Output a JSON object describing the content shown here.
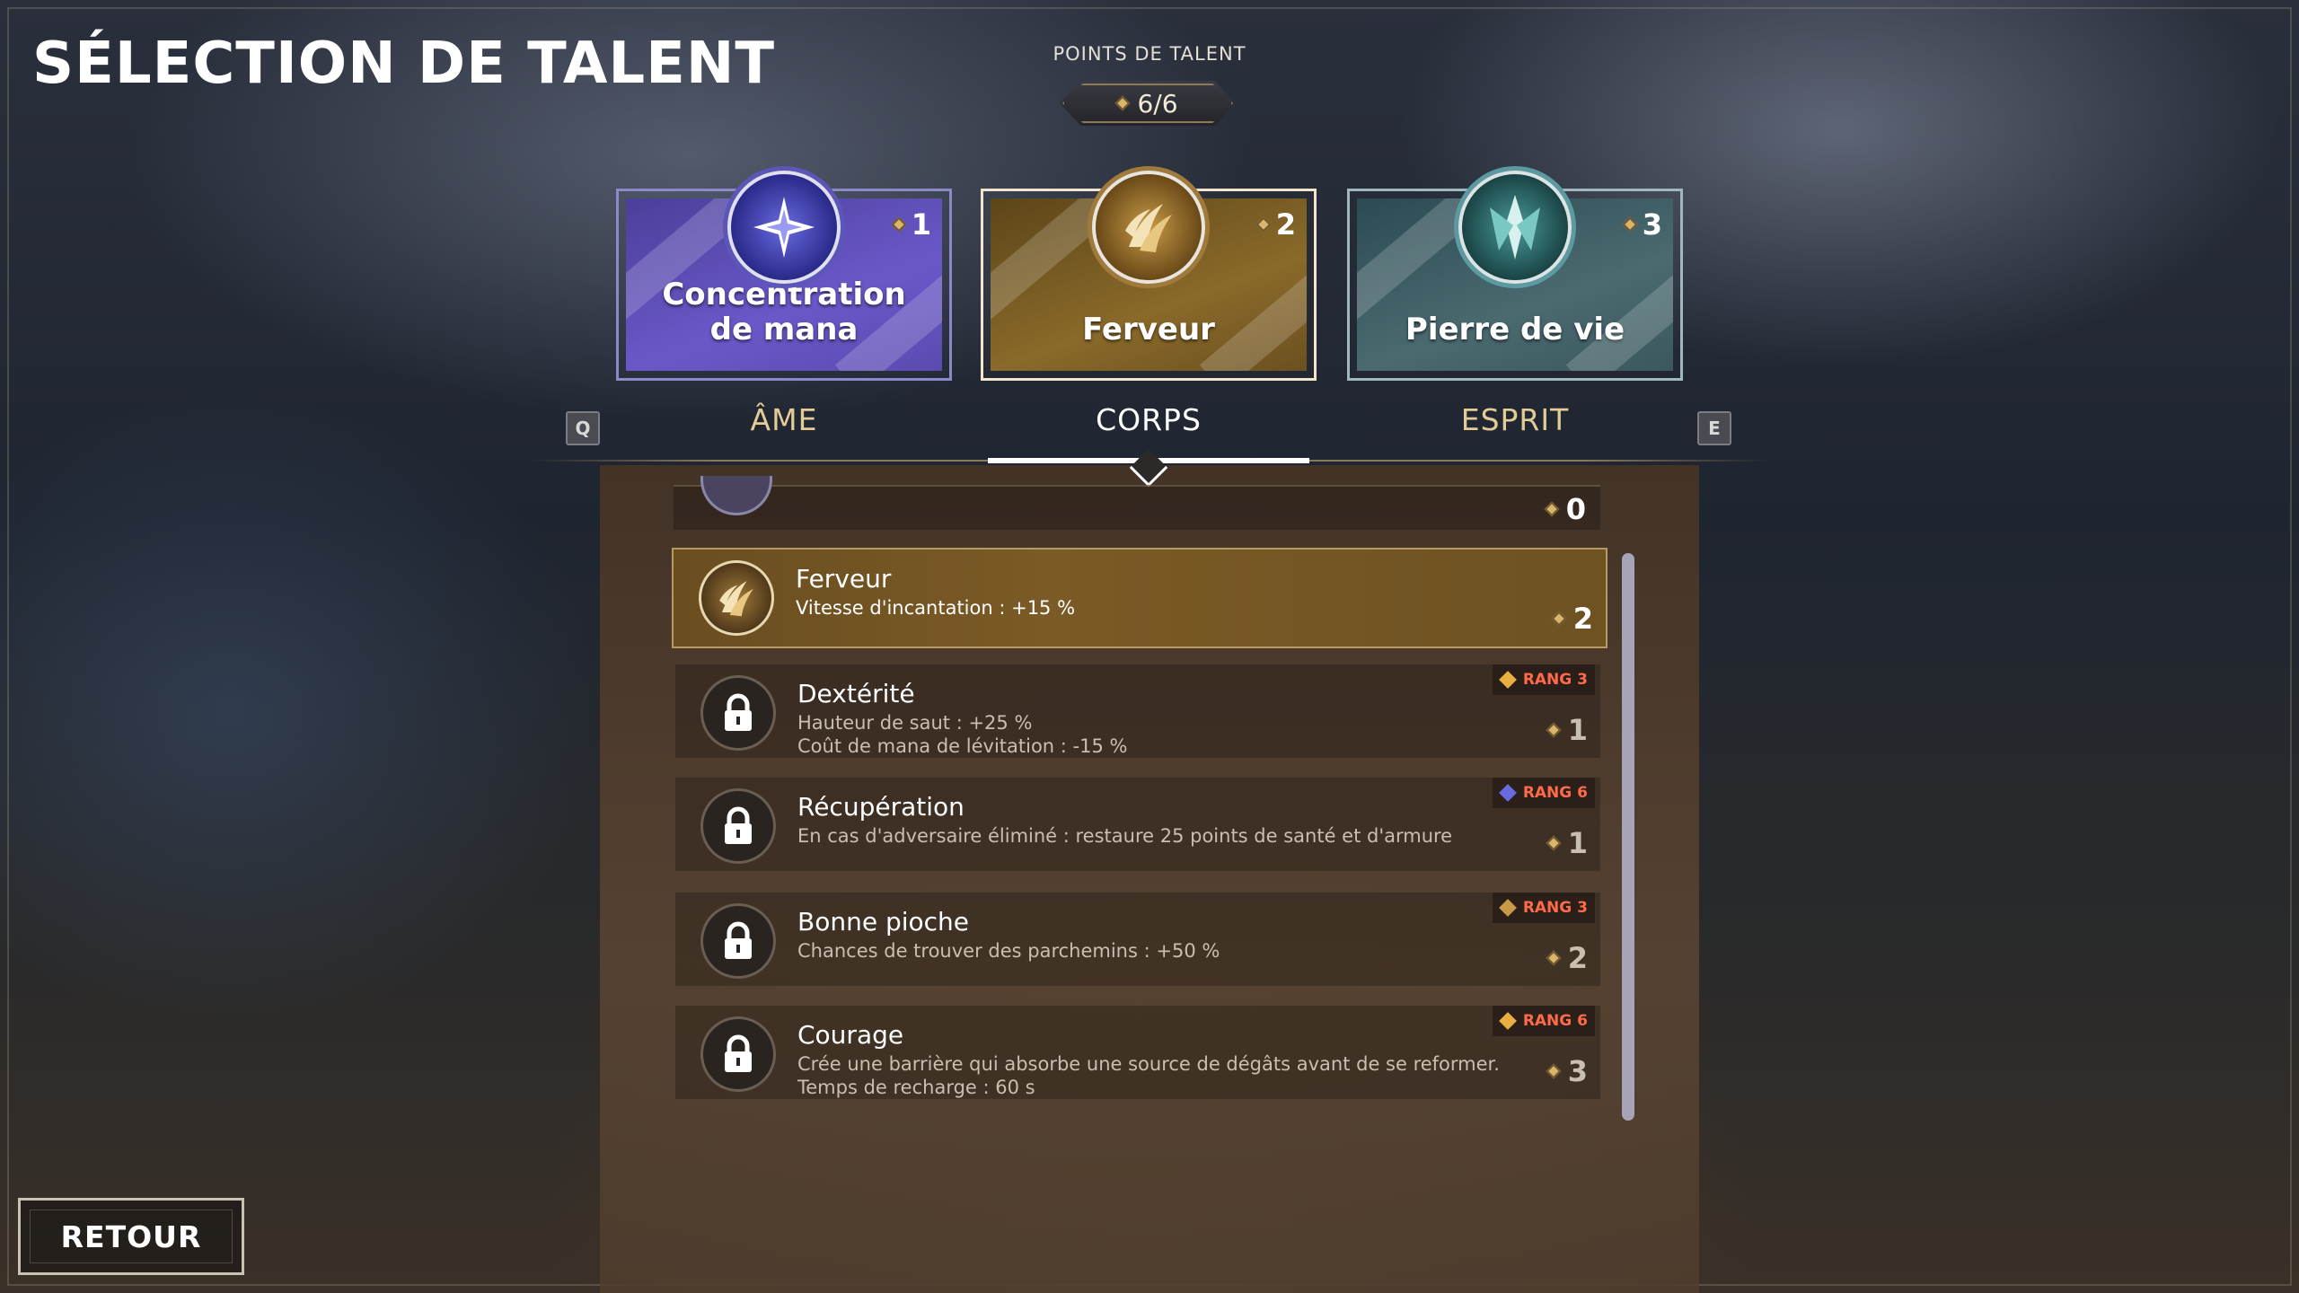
{
  "title": "SÉLECTION DE TALENT",
  "talent_points": {
    "label": "POINTS DE TALENT",
    "value": "6/6"
  },
  "categories": [
    {
      "name": "Concentration de mana",
      "cost": "1",
      "tab": "ÂME",
      "color": "#6a58c8",
      "icon": "star-burst-icon"
    },
    {
      "name": "Ferveur",
      "cost": "2",
      "tab": "CORPS",
      "color": "#8a6a2a",
      "icon": "claw-flame-icon",
      "active": true
    },
    {
      "name": "Pierre de vie",
      "cost": "3",
      "tab": "ESPRIT",
      "color": "#4a6a70",
      "icon": "crystal-icon"
    }
  ],
  "keys": {
    "prev": "Q",
    "next": "E"
  },
  "top_row": {
    "cost": "0"
  },
  "talents": [
    {
      "name": "Ferveur",
      "desc1": "Vitesse d'incantation : +15 %",
      "desc2": "",
      "cost": "2",
      "rank": "",
      "selected": true,
      "icon": "claw-flame-icon"
    },
    {
      "name": "Dextérité",
      "desc1": "Hauteur de saut : +25 %",
      "desc2": "Coût de mana de lévitation : -15 %",
      "cost": "1",
      "rank": "RANG 3",
      "rank_color": "#e8b040",
      "icon": "lock-icon"
    },
    {
      "name": "Récupération",
      "desc1": "En cas d'adversaire éliminé : restaure 25 points de santé et d'armure",
      "desc2": "",
      "cost": "1",
      "rank": "RANG 6",
      "rank_color": "#6a6ae0",
      "icon": "lock-icon"
    },
    {
      "name": "Bonne pioche",
      "desc1": "Chances de trouver des parchemins : +50 %",
      "desc2": "",
      "cost": "2",
      "rank": "RANG 3",
      "rank_color": "#c89a48",
      "icon": "lock-icon"
    },
    {
      "name": "Courage",
      "desc1": "Crée une barrière qui absorbe une source de dégâts avant de se reformer.",
      "desc2": "Temps de recharge : 60 s",
      "cost": "3",
      "rank": "RANG 6",
      "rank_color": "#e8b040",
      "icon": "lock-icon"
    }
  ],
  "back_button": "RETOUR"
}
